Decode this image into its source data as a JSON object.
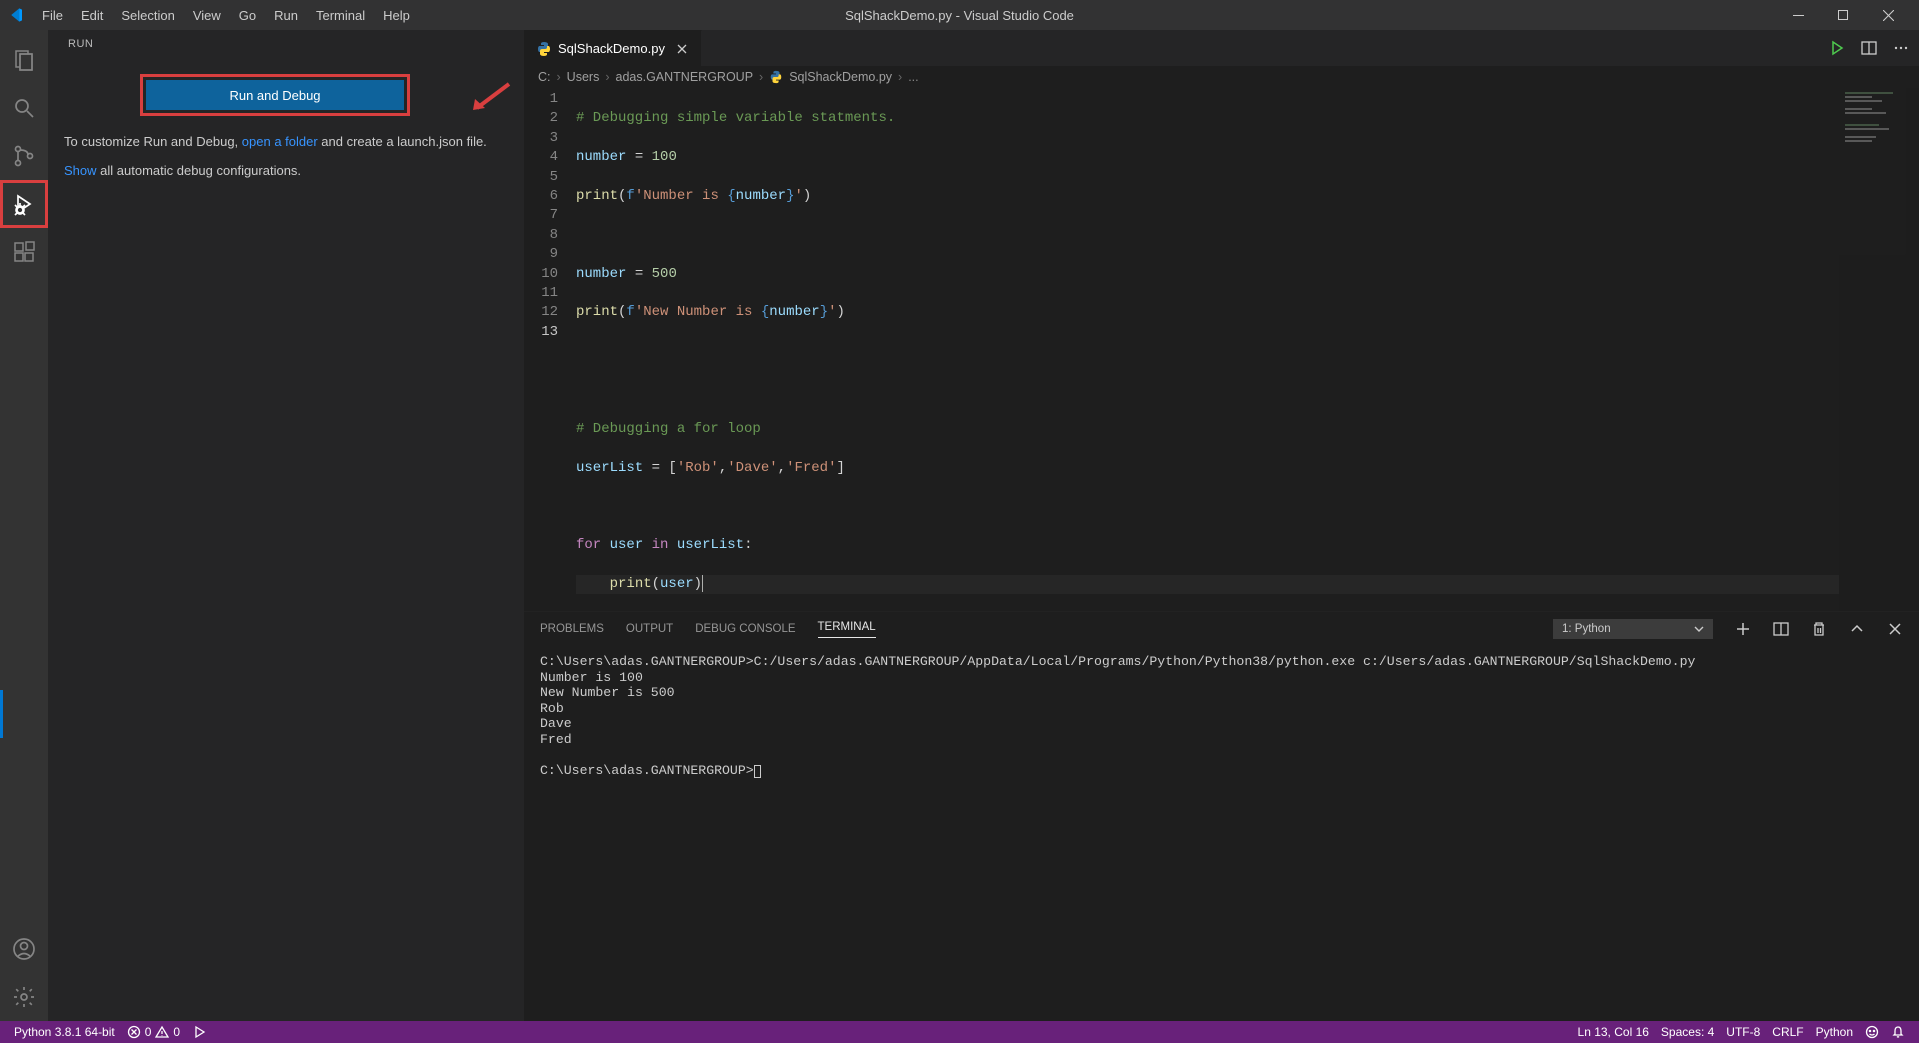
{
  "title": "SqlShackDemo.py - Visual Studio Code",
  "menu": [
    "File",
    "Edit",
    "Selection",
    "View",
    "Go",
    "Run",
    "Terminal",
    "Help"
  ],
  "sidebar": {
    "title": "RUN",
    "run_debug_button": "Run and Debug",
    "help_text_1_a": "To customize Run and Debug, ",
    "help_text_1_link": "open a folder",
    "help_text_1_b": " and create a launch.json file.",
    "help_text_2_link": "Show",
    "help_text_2_b": " all automatic debug configurations."
  },
  "tab": {
    "filename": "SqlShackDemo.py"
  },
  "breadcrumb": {
    "segs": [
      "C:",
      "Users",
      "adas.GANTNERGROUP"
    ],
    "file": "SqlShackDemo.py",
    "ell": "..."
  },
  "code": {
    "line_numbers": [
      "1",
      "2",
      "3",
      "4",
      "5",
      "6",
      "7",
      "8",
      "9",
      "10",
      "11",
      "12",
      "13"
    ]
  },
  "panel": {
    "tabs": {
      "problems": "PROBLEMS",
      "output": "OUTPUT",
      "debug": "DEBUG CONSOLE",
      "terminal": "TERMINAL"
    },
    "terminal_selector": "1: Python",
    "terminal": {
      "line1": "C:\\Users\\adas.GANTNERGROUP>C:/Users/adas.GANTNERGROUP/AppData/Local/Programs/Python/Python38/python.exe c:/Users/adas.GANTNERGROUP/SqlShackDemo.py",
      "line2": "Number is 100",
      "line3": "New Number is 500",
      "line4": "Rob",
      "line5": "Dave",
      "line6": "Fred",
      "prompt": "C:\\Users\\adas.GANTNERGROUP>"
    }
  },
  "status": {
    "python": "Python 3.8.1 64-bit",
    "errors": "0",
    "warnings": "0",
    "lncol": "Ln 13, Col 16",
    "spaces": "Spaces: 4",
    "encoding": "UTF-8",
    "eol": "CRLF",
    "lang": "Python",
    "feedback": ""
  }
}
